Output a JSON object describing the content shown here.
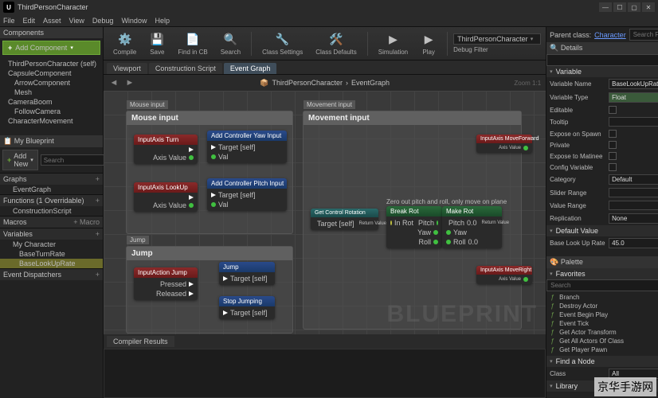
{
  "window": {
    "title": "ThirdPersonCharacter"
  },
  "menu": [
    "File",
    "Edit",
    "Asset",
    "View",
    "Debug",
    "Window",
    "Help"
  ],
  "window_controls": {
    "min": "—",
    "max": "☐",
    "sq": "▢",
    "close": "✕"
  },
  "components_panel": {
    "title": "Components",
    "add_button": "Add Component",
    "tree": [
      {
        "label": "ThirdPersonCharacter (self)",
        "depth": 0
      },
      {
        "label": "CapsuleComponent",
        "depth": 0
      },
      {
        "label": "ArrowComponent",
        "depth": 1
      },
      {
        "label": "Mesh",
        "depth": 1
      },
      {
        "label": "CameraBoom",
        "depth": 0
      },
      {
        "label": "FollowCamera",
        "depth": 1
      },
      {
        "label": "CharacterMovement",
        "depth": 0
      }
    ]
  },
  "my_blueprint": {
    "title": "My Blueprint",
    "add_new": "Add New",
    "search_placeholder": "Search",
    "sections": {
      "graphs": {
        "label": "Graphs",
        "items": [
          "EventGraph"
        ]
      },
      "functions": {
        "label": "Functions (1 Overridable)",
        "items": [
          "ConstructionScript"
        ]
      },
      "macros": {
        "label": "Macros",
        "add": "+ Macro"
      },
      "variables": {
        "label": "Variables",
        "items": [
          "My Character",
          "BaseTurnRate",
          "BaseLookUpRate"
        ]
      },
      "dispatchers": {
        "label": "Event Dispatchers"
      }
    }
  },
  "toolbar": {
    "buttons": [
      {
        "icon": "⚙️",
        "label": "Compile"
      },
      {
        "icon": "💾",
        "label": "Save"
      },
      {
        "icon": "📄",
        "label": "Find in CB"
      },
      {
        "icon": "🔍",
        "label": "Search"
      },
      {
        "icon": "🔧",
        "label": "Class Settings"
      },
      {
        "icon": "🛠️",
        "label": "Class Defaults"
      },
      {
        "icon": "▶",
        "label": "Simulation"
      },
      {
        "icon": "▶",
        "label": "Play"
      }
    ],
    "dropdown": "ThirdPersonCharacter",
    "debug_filter": "Debug Filter"
  },
  "tabs": {
    "viewport": "Viewport",
    "construction": "Construction Script",
    "eventgraph": "Event Graph"
  },
  "breadcrumb": {
    "root": "ThirdPersonCharacter",
    "leaf": "EventGraph"
  },
  "zoom": "Zoom 1:1",
  "graph": {
    "groups": {
      "mouse": {
        "tag": "Mouse input",
        "title": "Mouse input"
      },
      "movement": {
        "tag": "Movement input",
        "title": "Movement input"
      },
      "jump": {
        "tag": "Jump",
        "title": "Jump"
      }
    },
    "nodes": {
      "inputaxis_turn": "InputAxis Turn",
      "inputaxis_lookup": "InputAxis LookUp",
      "add_yaw": "Add Controller Yaw Input",
      "add_pitch": "Add Controller Pitch Input",
      "axis_value": "Axis Value",
      "val": "Val",
      "target_self": "Target [self]",
      "inputaxis_moveforward": "InputAxis MoveForward",
      "inputaxis_moveright": "InputAxis MoveRight",
      "get_control_rotation": "Get Control Rotation",
      "break_rot": "Break Rot",
      "make_rot": "Make Rot",
      "pitch": "Pitch",
      "yaw": "Yaw",
      "roll": "Roll",
      "in_rot": "In Rot",
      "return_value": "Return Value",
      "note": "Zero out pitch and roll, only move on plane",
      "inputaction_jump": "InputAction Jump",
      "jump_node": "Jump",
      "stop_jumping": "Stop Jumping",
      "pressed": "Pressed",
      "released": "Released",
      "target": "Target",
      "val_zero": "0.0"
    },
    "watermark": "BLUEPRINT"
  },
  "compiler": {
    "title": "Compiler Results"
  },
  "right": {
    "parent_class_label": "Parent class:",
    "parent_class": "Character",
    "search": "Search For Help",
    "details_title": "Details",
    "variable_section": "Variable",
    "rows": {
      "var_name": {
        "label": "Variable Name",
        "value": "BaseLookUpRate"
      },
      "var_type": {
        "label": "Variable Type",
        "value": "Float"
      },
      "editable": {
        "label": "Editable"
      },
      "tooltip": {
        "label": "Tooltip"
      },
      "expose_spawn": {
        "label": "Expose on Spawn"
      },
      "private": {
        "label": "Private"
      },
      "expose_matinee": {
        "label": "Expose to Matinee"
      },
      "config": {
        "label": "Config Variable"
      },
      "category": {
        "label": "Category",
        "value": "Default"
      },
      "slider": {
        "label": "Slider Range"
      },
      "value_range": {
        "label": "Value Range"
      },
      "replication": {
        "label": "Replication",
        "value": "None"
      }
    },
    "default_value_section": "Default Value",
    "default_value": {
      "label": "Base Look Up Rate",
      "value": "45.0"
    },
    "palette": {
      "title": "Palette",
      "favorites": "Favorites",
      "search": "Search",
      "items": [
        "Branch",
        "Destroy Actor",
        "Event Begin Play",
        "Event Tick",
        "Get Actor Transform",
        "Get All Actors Of Class",
        "Get Player Pawn"
      ]
    },
    "find_node": "Find a Node",
    "class_label": "Class",
    "class_value": "All",
    "library": "Library"
  },
  "corner": "京华手游网"
}
